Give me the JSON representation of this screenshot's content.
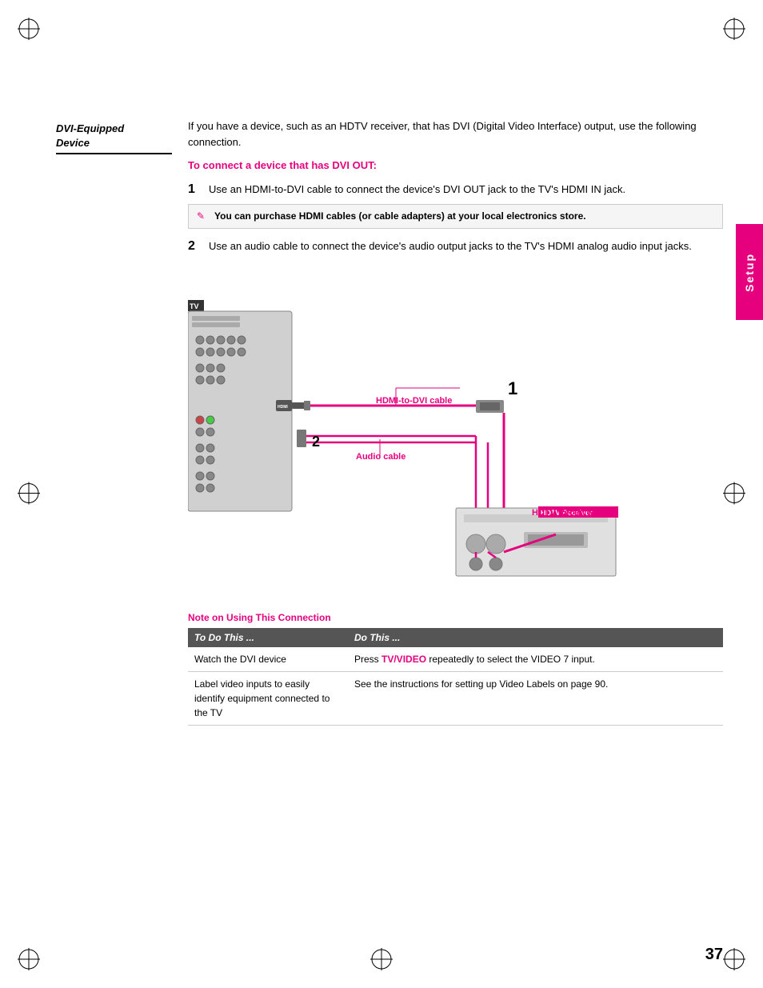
{
  "page": {
    "number": "37",
    "side_tab": "Setup"
  },
  "section": {
    "title_line1": "DVI-Equipped",
    "title_line2": "Device",
    "intro": "If you have a device, such as an HDTV receiver, that has DVI (Digital Video Interface) output, use the following connection.",
    "subheading": "To connect a device that has DVI OUT:",
    "step1": "Use an HDMI-to-DVI cable to connect the device's DVI OUT jack to the TV's HDMI IN jack.",
    "step2": "Use an audio cable to connect the device's audio output jacks to the TV's HDMI analog audio input jacks.",
    "note_text": "You can purchase HDMI cables (or cable adapters) at your local electronics store."
  },
  "diagram": {
    "tv_label": "TV",
    "hdmi_cable_label": "HDMI-to-DVI cable",
    "audio_cable_label": "Audio cable",
    "hdtv_label": "HDTV Receiver",
    "step1_num": "1",
    "step2_num": "2"
  },
  "note_section": {
    "heading": "Note on Using This Connection",
    "table": {
      "col1_header": "To Do This ...",
      "col2_header": "Do This ...",
      "rows": [
        {
          "col1": "Watch the DVI device",
          "col2_pre": "Press ",
          "col2_highlight": "TV/VIDEO",
          "col2_post": " repeatedly to select the VIDEO 7 input."
        },
        {
          "col1": "Label video inputs to easily identify equipment connected to the TV",
          "col2": "See the instructions for setting up Video Labels on page 90."
        }
      ]
    }
  }
}
